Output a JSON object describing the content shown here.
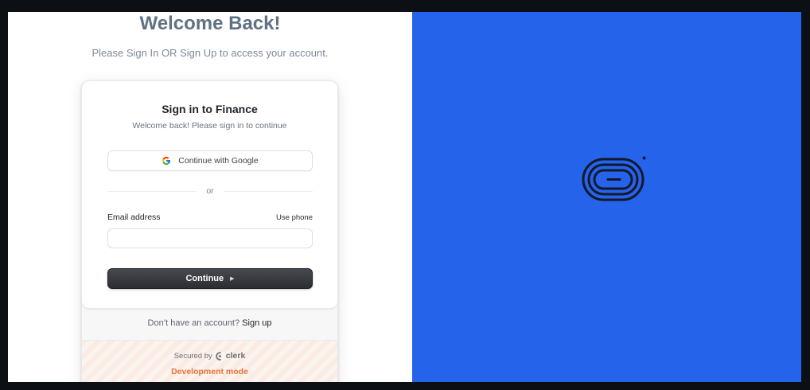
{
  "page": {
    "heading": "Welcome Back!",
    "subheading": "Please Sign In OR Sign Up to access your account."
  },
  "card": {
    "title": "Sign in to Finance",
    "subtitle": "Welcome back! Please sign in to continue",
    "google_button": "Continue with Google",
    "divider_text": "or",
    "email_label": "Email address",
    "use_phone": "Use phone",
    "email_value": "",
    "continue_button": "Continue",
    "no_account_text": "Don’t have an account?",
    "signup_link": "Sign up",
    "secured_by": "Secured by",
    "clerk_brand": "clerk",
    "dev_mode": "Development mode"
  },
  "colors": {
    "accent_panel": "#2563eb",
    "heading": "#5f7185",
    "dev_mode": "#e8753a"
  },
  "icons": {
    "google": "google-icon",
    "continue_arrow": "play-triangle-icon",
    "clerk": "clerk-logo-icon",
    "brand": "brand-logo-icon"
  }
}
